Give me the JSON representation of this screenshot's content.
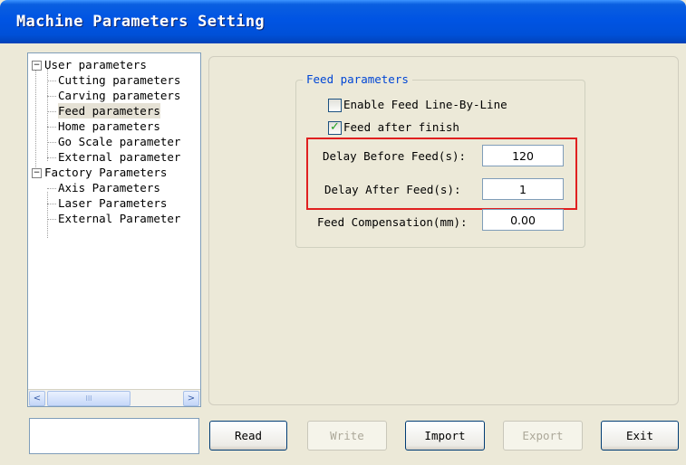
{
  "window": {
    "title": "Machine Parameters Setting"
  },
  "tree": {
    "items": [
      {
        "label": "User parameters",
        "level": 0,
        "expander": "−"
      },
      {
        "label": "Cutting parameters",
        "level": 1
      },
      {
        "label": "Carving parameters",
        "level": 1
      },
      {
        "label": "Feed parameters",
        "level": 1,
        "selected": true
      },
      {
        "label": "Home parameters",
        "level": 1
      },
      {
        "label": "Go Scale parameter",
        "level": 1
      },
      {
        "label": "External parameter",
        "level": 1
      },
      {
        "label": "Factory Parameters",
        "level": 0,
        "expander": "−"
      },
      {
        "label": "Axis Parameters",
        "level": 1
      },
      {
        "label": "Laser Parameters",
        "level": 1
      },
      {
        "label": "External Parameter",
        "level": 1
      }
    ],
    "scrollbar": {
      "left_arrow": "<",
      "right_arrow": ">",
      "thumb_grip": "III"
    }
  },
  "feed_group": {
    "title": "Feed parameters",
    "enable_line_by_line": {
      "label": "Enable Feed Line-By-Line",
      "checked": false
    },
    "feed_after_finish": {
      "label": "Feed after finish",
      "checked": true,
      "mark": "✓"
    },
    "delay_before": {
      "label": "Delay Before Feed(s):",
      "value": "120"
    },
    "delay_after": {
      "label": "Delay After Feed(s):",
      "value": "1"
    },
    "compensation": {
      "label": "Feed Compensation(mm):",
      "value": "0.00"
    }
  },
  "status": {
    "text": ""
  },
  "buttons": {
    "read": {
      "label": "Read",
      "enabled": true
    },
    "write": {
      "label": "Write",
      "enabled": false
    },
    "import": {
      "label": "Import",
      "enabled": true
    },
    "export": {
      "label": "Export",
      "enabled": false
    },
    "exit": {
      "label": "Exit",
      "enabled": true
    }
  },
  "colors": {
    "title_bar": "#0054e3",
    "group_title": "#0046d5",
    "highlight_box": "#e02020",
    "check_mark": "#21a121"
  }
}
